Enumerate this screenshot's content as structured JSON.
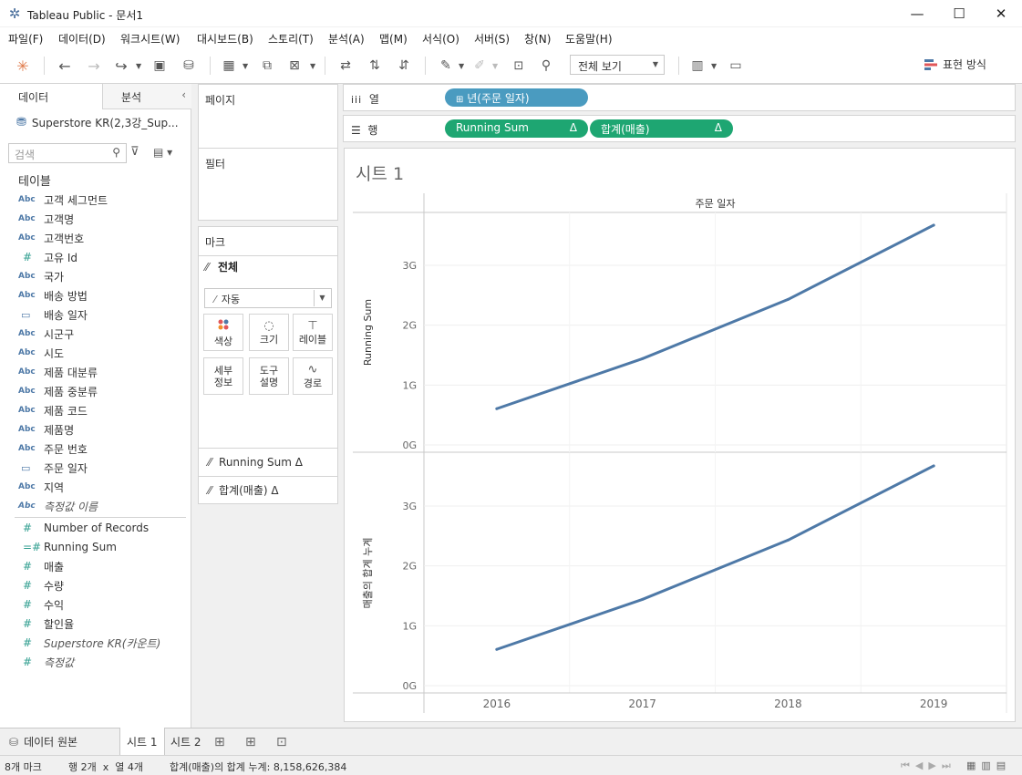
{
  "window": {
    "title": "Tableau Public - 문서1"
  },
  "menu": [
    "파일(F)",
    "데이터(D)",
    "워크시트(W)",
    "대시보드(B)",
    "스토리(T)",
    "분석(A)",
    "맵(M)",
    "서식(O)",
    "서버(S)",
    "창(N)",
    "도움말(H)"
  ],
  "toolbar": {
    "view_select": "전체 보기",
    "show_me": "표현 방식"
  },
  "data_pane": {
    "tab_data": "데이터",
    "tab_analysis": "분석",
    "datasource": "Superstore KR(2,3강_Sup...",
    "search_placeholder": "검색",
    "tables_header": "테이블",
    "dimensions": [
      {
        "type": "Abc",
        "name": "고객 세그먼트"
      },
      {
        "type": "Abc",
        "name": "고객명"
      },
      {
        "type": "Abc",
        "name": "고객번호"
      },
      {
        "type": "#",
        "name": "고유 Id"
      },
      {
        "type": "Abc",
        "name": "국가"
      },
      {
        "type": "Abc",
        "name": "배송 방법"
      },
      {
        "type": "date",
        "name": "배송 일자"
      },
      {
        "type": "Abc",
        "name": "시군구"
      },
      {
        "type": "Abc",
        "name": "시도"
      },
      {
        "type": "Abc",
        "name": "제품 대분류"
      },
      {
        "type": "Abc",
        "name": "제품 중분류"
      },
      {
        "type": "Abc",
        "name": "제품 코드"
      },
      {
        "type": "Abc",
        "name": "제품명"
      },
      {
        "type": "Abc",
        "name": "주문 번호"
      },
      {
        "type": "date",
        "name": "주문 일자"
      },
      {
        "type": "Abc",
        "name": "지역"
      },
      {
        "type": "Abc",
        "name": "측정값 이름",
        "italic": true
      }
    ],
    "measures": [
      {
        "type": "#",
        "name": "Number of Records"
      },
      {
        "type": "=#",
        "name": "Running Sum"
      },
      {
        "type": "#",
        "name": "매출"
      },
      {
        "type": "#",
        "name": "수량"
      },
      {
        "type": "#",
        "name": "수익"
      },
      {
        "type": "#",
        "name": "할인율"
      },
      {
        "type": "#",
        "name": "Superstore KR(카운트)",
        "italic": true
      },
      {
        "type": "#",
        "name": "측정값",
        "italic": true
      }
    ]
  },
  "cards": {
    "pages": "페이지",
    "filters": "필터",
    "marks": "마크",
    "marks_all": "전체",
    "mark_type": "자동",
    "buttons": [
      "색상",
      "크기",
      "레이블",
      "세부\n정보",
      "도구\n설명",
      "경로"
    ],
    "mark_fields": [
      "Running Sum Δ",
      "합계(매출) Δ"
    ]
  },
  "shelves": {
    "columns_label": "열",
    "rows_label": "행",
    "column_pill": "년(주문 일자)",
    "row_pills": [
      "Running Sum",
      "합계(매출)"
    ],
    "delta": "Δ"
  },
  "sheet": {
    "title": "시트 1",
    "header": "주문 일자"
  },
  "chart_data": [
    {
      "type": "line",
      "x": [
        "2016",
        "2017",
        "2018",
        "2019"
      ],
      "ylabel": "Running Sum",
      "ylim": [
        0,
        3700000000
      ],
      "yticks": [
        "0G",
        "1G",
        "2G",
        "3G"
      ],
      "values": [
        605000000,
        1440000000,
        2430000000,
        3670000000
      ]
    },
    {
      "type": "line",
      "x": [
        "2016",
        "2017",
        "2018",
        "2019"
      ],
      "ylabel": "매출의 합계 누계",
      "ylim": [
        0,
        3700000000
      ],
      "yticks": [
        "0G",
        "1G",
        "2G",
        "3G"
      ],
      "values": [
        605000000,
        1440000000,
        2430000000,
        3670000000
      ]
    }
  ],
  "colors": {
    "line": "#4e79a7",
    "measure_pill": "#1ea672",
    "dimension_pill": "#4a9bc0"
  },
  "bottom_tabs": [
    "데이터 원본",
    "시트 1",
    "시트 2"
  ],
  "status": {
    "marks": "8개 마크",
    "rows_cols": "행 2개  x  열 4개",
    "sum": "합계(매출)의 합계 누계: 8,158,626,384"
  }
}
